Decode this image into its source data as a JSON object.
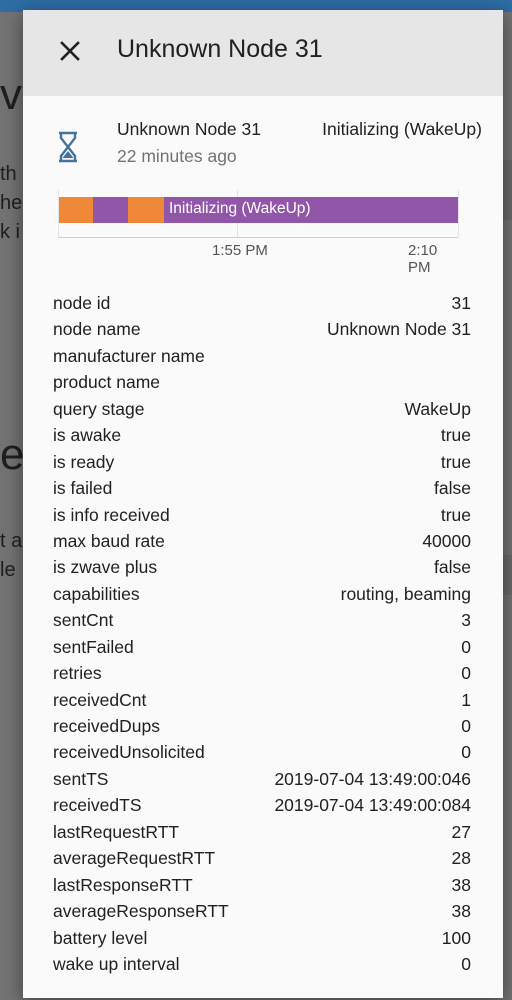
{
  "dialog": {
    "title": "Unknown Node 31",
    "close_icon": "close-icon"
  },
  "state_card": {
    "icon": "hourglass-icon",
    "name": "Unknown Node 31",
    "last_changed": "22 minutes ago",
    "state": "Initializing (WakeUp)"
  },
  "timeline": {
    "segments": [
      {
        "state": "orange-state",
        "color": "#f0883a"
      },
      {
        "state": "Initializing (WakeUp)",
        "color": "#9256a8"
      },
      {
        "state": "orange-state",
        "color": "#f0883a"
      },
      {
        "state": "Initializing (WakeUp)",
        "color": "#9256a8"
      }
    ],
    "label": "Initializing (WakeUp)",
    "ticks": [
      "1:55 PM",
      "2:10 PM"
    ]
  },
  "attributes": [
    {
      "k": "node id",
      "v": "31"
    },
    {
      "k": "node name",
      "v": "Unknown Node 31"
    },
    {
      "k": "manufacturer name",
      "v": ""
    },
    {
      "k": "product name",
      "v": ""
    },
    {
      "k": "query stage",
      "v": "WakeUp"
    },
    {
      "k": "is awake",
      "v": "true"
    },
    {
      "k": "is ready",
      "v": "true"
    },
    {
      "k": "is failed",
      "v": "false"
    },
    {
      "k": "is info received",
      "v": "true"
    },
    {
      "k": "max baud rate",
      "v": "40000"
    },
    {
      "k": "is zwave plus",
      "v": "false"
    },
    {
      "k": "capabilities",
      "v": "routing, beaming"
    },
    {
      "k": "sentCnt",
      "v": "3"
    },
    {
      "k": "sentFailed",
      "v": "0"
    },
    {
      "k": "retries",
      "v": "0"
    },
    {
      "k": "receivedCnt",
      "v": "1"
    },
    {
      "k": "receivedDups",
      "v": "0"
    },
    {
      "k": "receivedUnsolicited",
      "v": "0"
    },
    {
      "k": "sentTS",
      "v": "2019-07-04 13:49:00:046"
    },
    {
      "k": "receivedTS",
      "v": "2019-07-04 13:49:00:084"
    },
    {
      "k": "lastRequestRTT",
      "v": "27"
    },
    {
      "k": "averageRequestRTT",
      "v": "28"
    },
    {
      "k": "lastResponseRTT",
      "v": "38"
    },
    {
      "k": "averageResponseRTT",
      "v": "38"
    },
    {
      "k": "battery level",
      "v": "100"
    },
    {
      "k": "wake up interval",
      "v": "0"
    }
  ],
  "colors": {
    "accent_orange": "#f0883a",
    "accent_purple": "#9256a8",
    "icon_blue": "#44739e"
  }
}
